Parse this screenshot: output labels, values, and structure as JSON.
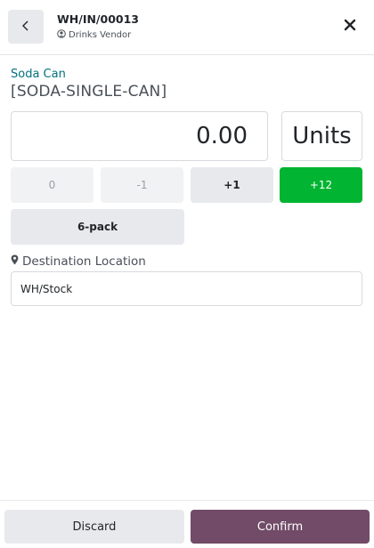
{
  "header": {
    "title": "WH/IN/00013",
    "partner": "Drinks Vendor",
    "back_icon": "chevron-left-icon",
    "close_icon": "close-icon",
    "partner_icon": "user-circle-icon"
  },
  "product": {
    "name": "Soda Can",
    "code": "[SODA-SINGLE-CAN]"
  },
  "quantity": {
    "value": "0.00",
    "uom": "Units"
  },
  "quantity_buttons": {
    "zero": "0",
    "minus1": "-1",
    "plus1": "+1",
    "plus12": "+12",
    "package": "6-pack"
  },
  "destination": {
    "label": "Destination Location",
    "icon": "map-marker-icon",
    "value": "WH/Stock"
  },
  "footer": {
    "discard_label": "Discard",
    "confirm_label": "Confirm"
  },
  "colors": {
    "accent_teal": "#01707f",
    "green": "#01b431",
    "primary": "#714b67",
    "button_gray": "#e7e9ed"
  }
}
